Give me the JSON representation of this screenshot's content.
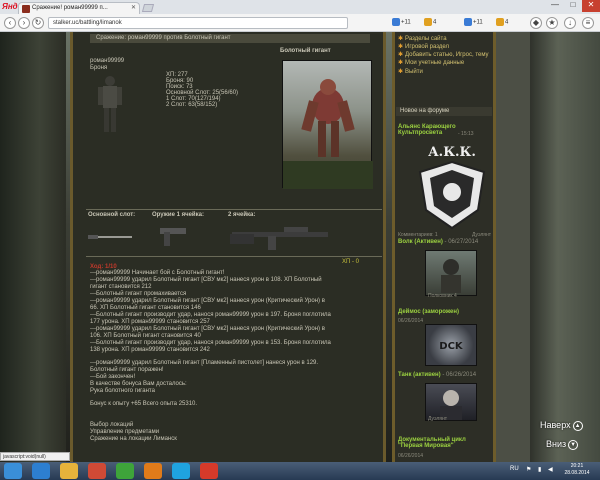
{
  "browser": {
    "brand": "Яндекс",
    "tab_title": "Сражение! роман99999 п...",
    "url": "stalker.uc/battling/limanok",
    "extensions": [
      {
        "label": "+11",
        "color": "#3a7bd5",
        "icon": "cloud-icon"
      },
      {
        "label": "4",
        "color": "#e0a020",
        "icon": "mail-icon"
      },
      {
        "label": "+11",
        "color": "#3a7bd5",
        "icon": "cloud-icon"
      },
      {
        "label": "4",
        "color": "#e0a020",
        "icon": "mail-icon"
      }
    ],
    "window_buttons": {
      "minimize": "—",
      "maximize": "□",
      "close": "✕"
    }
  },
  "main": {
    "header": "Сражение: роман99999 против Болотный гигант",
    "player": {
      "name": "роман99999",
      "subtitle": "Броня",
      "stats": [
        "ХП: 277",
        "Броня: 90",
        "Поиск: 73",
        "Основной Слот: 25(56/60)",
        "1 Слот: 70(127/194)",
        "2 Слот: 63(58/152)"
      ]
    },
    "monster_name": "Болотный гигант",
    "slots": {
      "main": "Основной слот:",
      "weapon1": "Оружие 1 ячейка:",
      "weapon2": "2 ячейка:"
    },
    "hp_marker": "ХП - 0",
    "log_title": "Ход: 1/10",
    "log": [
      "---роман99999 Начинает бой с Болотный гигант!",
      "---роман99999 ударил Болотный гигант [СВУ мк2] нанеся урон в 108. ХП Болотный",
      "гигант становится 212",
      "---Болотный гигант промахивается",
      "---роман99999 ударил Болотный гигант [СВУ мк2] нанеся урон (Критический Урон) в",
      "66. ХП Болотный гигант становится 146",
      "---Болотный гигант производит удар, нанося роман99999 урон в 197. Броня поглотила",
      "177 урона. ХП роман99999 становится 257",
      "---роман99999 ударил Болотный гигант [СВУ мк2] нанеся урон (Критический Урон) в",
      "106. ХП Болотный гигант становится 40",
      "---Болотный гигант производит удар, нанося роман99999 урон в 153. Броня поглотила",
      "138 урона. ХП роман99999 становится 242",
      "",
      "---роман99999 ударил Болотный гигант [Пламенный пистолет] нанеся урон в 129.",
      "Болотный гигант поражен!",
      "---Бой закончен!",
      "В качестве бонуса Вам досталось:",
      "Рука болотного гиганта",
      "",
      "Бонус к опыту +65 Всего опыта 25310."
    ],
    "links": [
      "Выбор локаций",
      "Управление предметами",
      "Сражение на локации Лиманск"
    ]
  },
  "sidebar": {
    "menu": [
      "Разделы сайта",
      "Игровой раздел",
      "Добавить статью, Игрос, тему",
      "Мои учетные данные",
      "Выйти"
    ],
    "news_header": "Новое на форуме",
    "posts": [
      {
        "title": "Альянс Карающего Культпросвета",
        "sub": "- 15:13"
      },
      {
        "title": "Волк (Активен)",
        "sub": "- 06/27/2014"
      },
      {
        "title": "Деймос (заморожен)",
        "sub": "06/26/2014"
      },
      {
        "title": "Танк (активен)",
        "sub": "- 06/26/2014"
      },
      {
        "title": "Документальный цикл \"Первая Мировая\"",
        "sub": "06/26/2014"
      }
    ],
    "logo_text": "А.К.К.",
    "small_captions": [
      "Полковник 4",
      "Дуэлянт",
      "Комментариев: 1",
      "Дуэлянт"
    ]
  },
  "float_buttons": {
    "up": "Наверх",
    "down": "Вниз"
  },
  "status_bar": "javascript:void(null)",
  "taskbar": {
    "lang": "RU",
    "time": "20:21",
    "date": "28.08.2014",
    "apps": [
      {
        "icon": "windows-start-icon",
        "color": "#3a8fd8"
      },
      {
        "icon": "ie-icon",
        "color": "#2d7fd0"
      },
      {
        "icon": "folder-icon",
        "color": "#e6b33b"
      },
      {
        "icon": "chrome-icon",
        "color": "#d04a36"
      },
      {
        "icon": "green-app-icon",
        "color": "#3ea43a"
      },
      {
        "icon": "firefox-icon",
        "color": "#e07b1a"
      },
      {
        "icon": "skype-icon",
        "color": "#1fa3e0"
      },
      {
        "icon": "yandex-browser-icon",
        "color": "#d63a2a"
      }
    ]
  }
}
